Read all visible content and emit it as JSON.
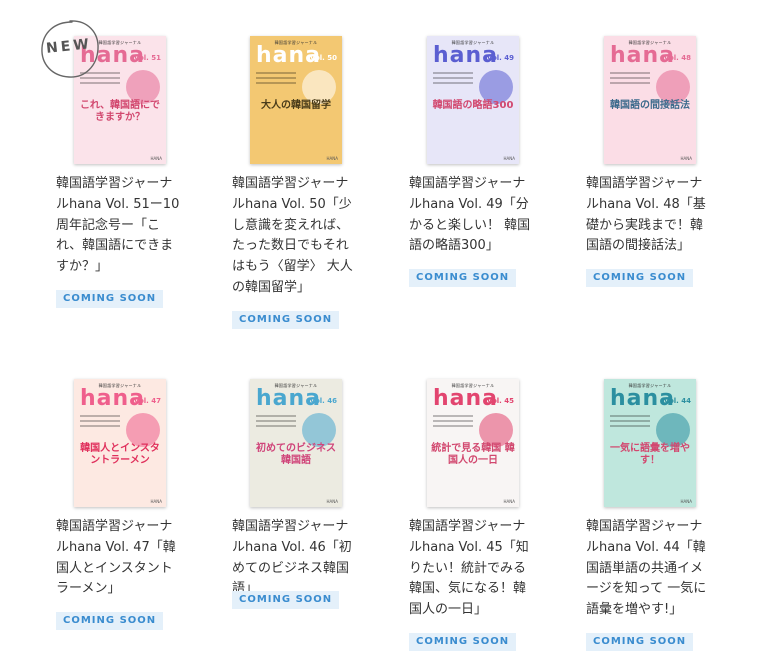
{
  "new_label": "NEW",
  "badge_label": "COMING SOON",
  "books": [
    {
      "series": "韓国語学習ジャーナル",
      "mast": "hana",
      "vol": "Vol. 51",
      "feature": "これ、韓国語にできますか？",
      "title": "韓国語学習ジャーナルhana Vol. 51ー10周年記念号ー「これ、韓国語にできますか？」",
      "bg": "#fbe3ea",
      "accent": "#e56b94",
      "feature_color": "#d2486f"
    },
    {
      "series": "韓国語学習ジャーナル",
      "mast": "hana",
      "vol": "Vol. 50",
      "feature": "大人の韓国留学",
      "title": "韓国語学習ジャーナルhana Vol. 50「少し意識を変えれば、たった数日でもそれはもう〈留学〉 大人の韓国留学」",
      "bg": "#f3c872",
      "accent": "#ffffff",
      "feature_color": "#4a3c1a"
    },
    {
      "series": "韓国語学習ジャーナル",
      "mast": "hana",
      "vol": "Vol. 49",
      "feature": "韓国語の略語300",
      "title": "韓国語学習ジャーナルhana Vol. 49「分かると楽しい！ 韓国語の略語300」",
      "bg": "#e7e6f8",
      "accent": "#5b5ed1",
      "feature_color": "#d2486f"
    },
    {
      "series": "韓国語学習ジャーナル",
      "mast": "hana",
      "vol": "Vol. 48",
      "feature": "韓国語の間接話法",
      "title": "韓国語学習ジャーナルhana Vol. 48「基礎から実践まで！韓国語の間接話法」",
      "bg": "#fbdde6",
      "accent": "#e56b94",
      "feature_color": "#3c6a8c"
    },
    {
      "series": "韓国語学習ジャーナル",
      "mast": "hana",
      "vol": "Vol. 47",
      "feature": "韓国人とインスタントラーメン",
      "title": "韓国語学習ジャーナルhana Vol. 47「韓国人とインスタントラーメン」",
      "bg": "#fde9e2",
      "accent": "#ef5f8c",
      "feature_color": "#e0305c"
    },
    {
      "series": "韓国語学習ジャーナル",
      "mast": "hana",
      "vol": "Vol. 46",
      "feature": "初めてのビジネス韓国語",
      "title": "韓国語学習ジャーナルhana Vol. 46「初めてのビジネス韓国語」",
      "bg": "#ecebe1",
      "accent": "#4aa7cf",
      "feature_color": "#d0457a"
    },
    {
      "series": "韓国語学習ジャーナル",
      "mast": "hana",
      "vol": "Vol. 45",
      "feature": "統計で見る韓国 韓国人の一日",
      "title": "韓国語学習ジャーナルhana Vol. 45「知りたい！統計でみる韓国、気になる！韓国人の一日」",
      "bg": "#f8f5f4",
      "accent": "#e2456f",
      "feature_color": "#d2486f"
    },
    {
      "series": "韓国語学習ジャーナル",
      "mast": "hana",
      "vol": "Vol. 44",
      "feature": "一気に語彙を増やす！",
      "title": "韓国語学習ジャーナルhana Vol. 44「韓国語単語の共通イメージを知って 一気に語彙を増やす!」",
      "bg": "#bfe7dd",
      "accent": "#2b8fa0",
      "feature_color": "#d2486f"
    }
  ]
}
